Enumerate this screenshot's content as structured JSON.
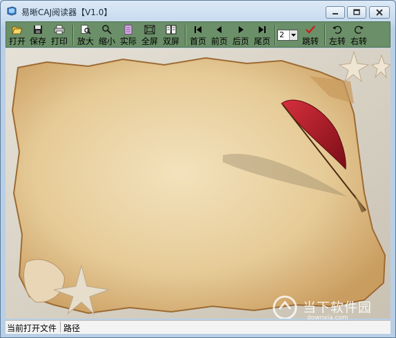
{
  "window": {
    "title": "易晰CAJ阅读器【V1.0】"
  },
  "toolbar": {
    "open": "打开",
    "save": "保存",
    "print": "打印",
    "zoom_in": "放大",
    "zoom_out": "缩小",
    "actual": "实际",
    "fullscreen": "全屏",
    "double_page": "双屏",
    "first_page": "首页",
    "prev_page": "前页",
    "next_page": "后页",
    "last_page": "尾页",
    "page_value": "2",
    "jump": "跳转",
    "rotate_left": "左转",
    "rotate_right": "右转"
  },
  "status": {
    "current_file_label": "当前打开文件",
    "path_label": "路径"
  },
  "watermark": {
    "name": "当下软件园",
    "url": "downxia.com"
  },
  "colors": {
    "toolbar_bg": "#6b8f68",
    "parchment": "#e6cfa2",
    "quill_red": "#b0182a"
  }
}
